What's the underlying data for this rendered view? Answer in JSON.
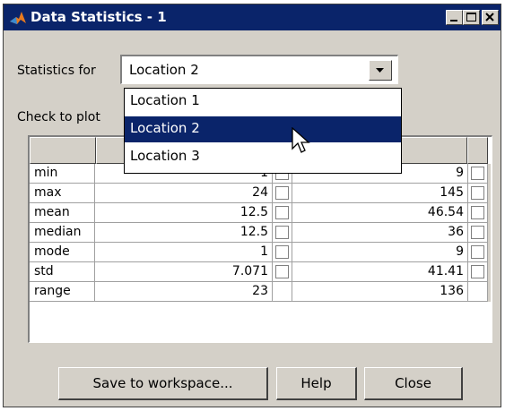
{
  "window": {
    "title": "Data Statistics - 1"
  },
  "controls": {
    "stats_for_label": "Statistics for",
    "selected_location": "Location 2",
    "check_to_plot_label": "Check to plot"
  },
  "dropdown_options": [
    "Location 1",
    "Location 2",
    "Location 3"
  ],
  "table": {
    "rows": [
      {
        "label": "min",
        "v1": "1",
        "v2": "9"
      },
      {
        "label": "max",
        "v1": "24",
        "v2": "145"
      },
      {
        "label": "mean",
        "v1": "12.5",
        "v2": "46.54"
      },
      {
        "label": "median",
        "v1": "12.5",
        "v2": "36"
      },
      {
        "label": "mode",
        "v1": "1",
        "v2": "9"
      },
      {
        "label": "std",
        "v1": "7.071",
        "v2": "41.41"
      },
      {
        "label": "range",
        "v1": "23",
        "v2": "136"
      }
    ]
  },
  "buttons": {
    "save": "Save to workspace...",
    "help": "Help",
    "close": "Close"
  },
  "colors": {
    "titlebar": "#0a246a",
    "window_bg": "#d4d0c8",
    "selection": "#0a246a"
  }
}
